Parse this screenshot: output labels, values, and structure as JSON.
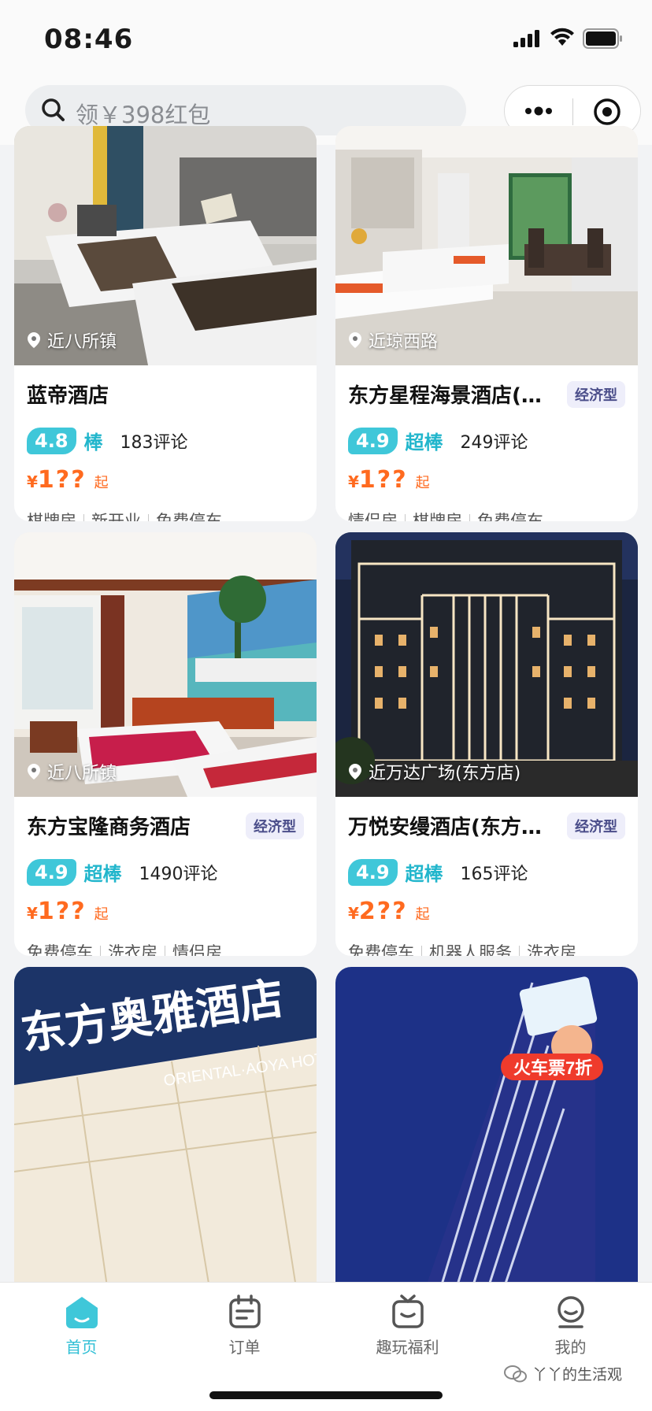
{
  "status_bar": {
    "time": "08:46"
  },
  "search": {
    "placeholder": "领￥398红包"
  },
  "hotels": [
    {
      "location": "近八所镇",
      "name": "蓝帝酒店",
      "type_tag": "",
      "score": "4.8",
      "score_word": "棒",
      "reviews": "183评论",
      "price_symbol": "¥",
      "price": "1??",
      "price_suffix": "起",
      "tags": [
        "棋牌房",
        "新开业",
        "免费停车"
      ]
    },
    {
      "location": "近琼西路",
      "name": "东方星程海景酒店(…",
      "type_tag": "经济型",
      "score": "4.9",
      "score_word": "超棒",
      "reviews": "249评论",
      "price_symbol": "¥",
      "price": "1??",
      "price_suffix": "起",
      "tags": [
        "情侣房",
        "棋牌房",
        "免费停车"
      ]
    },
    {
      "location": "近八所镇",
      "name": "东方宝隆商务酒店",
      "type_tag": "经济型",
      "score": "4.9",
      "score_word": "超棒",
      "reviews": "1490评论",
      "price_symbol": "¥",
      "price": "1??",
      "price_suffix": "起",
      "tags": [
        "免费停车",
        "洗衣房",
        "情侣房"
      ]
    },
    {
      "location": "近万达广场(东方店)",
      "name": "万悦安缦酒店(东方…",
      "type_tag": "经济型",
      "score": "4.9",
      "score_word": "超棒",
      "reviews": "165评论",
      "price_symbol": "¥",
      "price": "2??",
      "price_suffix": "起",
      "tags": [
        "免费停车",
        "机器人服务",
        "洗衣房"
      ]
    }
  ],
  "partial_cards": {
    "left_sign_text": "东方奥雅酒店",
    "left_sign_en": "ORIENTAL·AOYA HOTEL",
    "right_promo": "火车票7折"
  },
  "tabs": [
    {
      "label": "首页",
      "active": true
    },
    {
      "label": "订单",
      "active": false
    },
    {
      "label": "趣玩福利",
      "active": false
    },
    {
      "label": "我的",
      "active": false
    }
  ],
  "watermark": "丫丫的生活观",
  "colors": {
    "accent": "#3fc7d9",
    "price": "#ff6a1f",
    "tag_bg": "#eeeefa"
  }
}
